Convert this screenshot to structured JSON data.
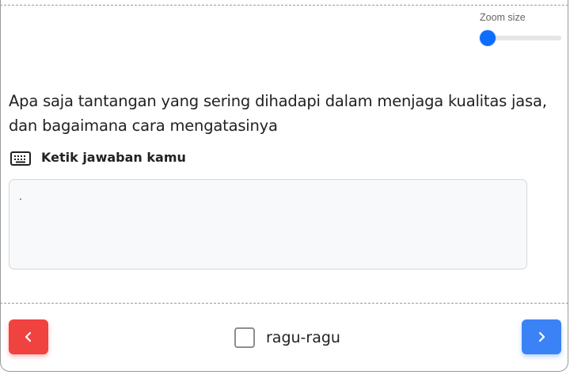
{
  "zoom": {
    "label": "Zoom size",
    "value_fraction": 0.0
  },
  "question": {
    "text": "Apa saja tantangan yang sering dihadapi dalam menjaga kualitas jasa, dan bagaimana cara mengatasinya"
  },
  "answer": {
    "label": "Ketik jawaban kamu",
    "value": ".",
    "icon": "keyboard-icon"
  },
  "footer": {
    "prev_icon": "chevron-left-icon",
    "next_icon": "chevron-right-icon",
    "doubt_label": "ragu-ragu",
    "doubt_checked": false
  },
  "colors": {
    "accent": "#0d6efd",
    "prev_button": "#f0423f",
    "next_button": "#3b82f6"
  }
}
